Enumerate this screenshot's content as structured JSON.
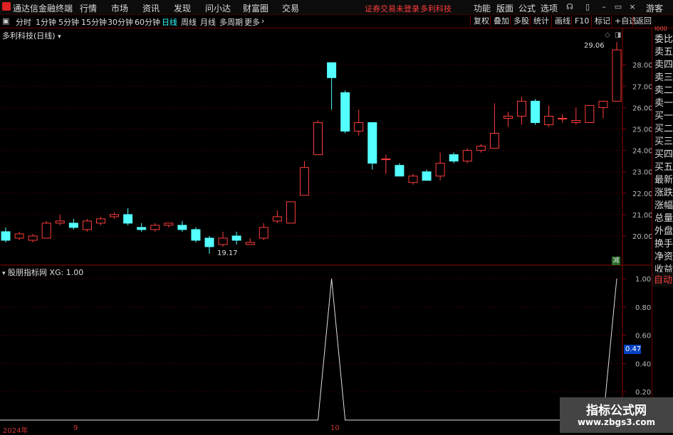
{
  "app": {
    "title": "通达信金融终端"
  },
  "menu": [
    "行情",
    "市场",
    "资讯",
    "发现",
    "问小达",
    "财富圈",
    "交易"
  ],
  "warning": "证券交易未登录",
  "stock_name": "多利科技",
  "right_menu": [
    "功能",
    "版面",
    "公式",
    "选项"
  ],
  "guest": "游客",
  "periods": [
    "分时",
    "1分钟",
    "5分钟",
    "15分钟",
    "30分钟",
    "60分钟",
    "日线",
    "周线",
    "月线",
    "多周期",
    "更多"
  ],
  "active_period": "日线",
  "tools": [
    "复权",
    "叠加",
    "多股",
    "统计",
    "画线",
    "F10",
    "标记",
    "+自选",
    "返回"
  ],
  "chart_title": "多利科技(日线)",
  "right_panel": [
    "委比",
    "卖五",
    "卖四",
    "卖三",
    "卖二",
    "卖一",
    "买一",
    "买二",
    "买三",
    "买四",
    "买五",
    "最新",
    "涨跌",
    "涨幅",
    "总量",
    "外盘",
    "换手",
    "净资",
    "收益"
  ],
  "auto_label": "自动",
  "max_label": "29.06",
  "min_label": "19.17",
  "jian": "减",
  "indicator_title": "股朋指标网  XG: 1.00",
  "indicator_current": "0.47",
  "dates": [
    "2024年",
    "9",
    "10"
  ],
  "watermark": {
    "line1": "指标公式网",
    "line2": "www.zbgs3.com"
  },
  "chart_data": {
    "type": "candlestick",
    "title": "多利科技(日线)",
    "y_ticks": [
      20.0,
      21.0,
      22.0,
      23.0,
      24.0,
      25.0,
      26.0,
      27.0,
      28.0
    ],
    "candles": [
      {
        "o": 20.2,
        "c": 19.8,
        "h": 20.4,
        "l": 19.7
      },
      {
        "o": 19.9,
        "c": 20.1,
        "h": 20.2,
        "l": 19.8
      },
      {
        "o": 19.8,
        "c": 20.0,
        "h": 20.1,
        "l": 19.7
      },
      {
        "o": 19.9,
        "c": 20.6,
        "h": 20.7,
        "l": 19.9
      },
      {
        "o": 20.6,
        "c": 20.7,
        "h": 21.0,
        "l": 20.5
      },
      {
        "o": 20.6,
        "c": 20.4,
        "h": 20.8,
        "l": 20.3
      },
      {
        "o": 20.3,
        "c": 20.7,
        "h": 20.8,
        "l": 20.2
      },
      {
        "o": 20.6,
        "c": 20.8,
        "h": 20.9,
        "l": 20.5
      },
      {
        "o": 20.9,
        "c": 21.0,
        "h": 21.1,
        "l": 20.8
      },
      {
        "o": 21.0,
        "c": 20.6,
        "h": 21.3,
        "l": 20.5
      },
      {
        "o": 20.4,
        "c": 20.3,
        "h": 20.6,
        "l": 20.2
      },
      {
        "o": 20.3,
        "c": 20.5,
        "h": 20.6,
        "l": 20.2
      },
      {
        "o": 20.5,
        "c": 20.6,
        "h": 20.6,
        "l": 20.4
      },
      {
        "o": 20.5,
        "c": 20.3,
        "h": 20.7,
        "l": 20.2
      },
      {
        "o": 20.3,
        "c": 19.8,
        "h": 20.4,
        "l": 19.7
      },
      {
        "o": 19.9,
        "c": 19.5,
        "h": 20.0,
        "l": 19.17
      },
      {
        "o": 19.6,
        "c": 19.9,
        "h": 20.2,
        "l": 19.5
      },
      {
        "o": 20.0,
        "c": 19.8,
        "h": 20.2,
        "l": 19.6
      },
      {
        "o": 19.6,
        "c": 19.7,
        "h": 19.9,
        "l": 19.6
      },
      {
        "o": 19.9,
        "c": 20.4,
        "h": 20.6,
        "l": 19.8
      },
      {
        "o": 20.7,
        "c": 20.9,
        "h": 21.2,
        "l": 20.6
      },
      {
        "o": 20.6,
        "c": 21.6,
        "h": 21.6,
        "l": 20.6
      },
      {
        "o": 21.9,
        "c": 23.2,
        "h": 23.5,
        "l": 21.9
      },
      {
        "o": 23.8,
        "c": 25.3,
        "h": 25.4,
        "l": 23.8
      },
      {
        "o": 28.1,
        "c": 27.4,
        "h": 28.1,
        "l": 25.9
      },
      {
        "o": 26.7,
        "c": 24.9,
        "h": 26.8,
        "l": 24.8
      },
      {
        "o": 24.9,
        "c": 25.3,
        "h": 25.9,
        "l": 24.7
      },
      {
        "o": 25.3,
        "c": 23.4,
        "h": 25.3,
        "l": 23.1
      },
      {
        "o": 23.6,
        "c": 23.6,
        "h": 23.8,
        "l": 22.9
      },
      {
        "o": 23.3,
        "c": 22.8,
        "h": 23.4,
        "l": 22.8
      },
      {
        "o": 22.5,
        "c": 22.8,
        "h": 22.9,
        "l": 22.4
      },
      {
        "o": 23.0,
        "c": 22.6,
        "h": 23.1,
        "l": 22.6
      },
      {
        "o": 22.8,
        "c": 23.4,
        "h": 23.9,
        "l": 22.6
      },
      {
        "o": 23.8,
        "c": 23.5,
        "h": 23.9,
        "l": 23.4
      },
      {
        "o": 23.5,
        "c": 24.0,
        "h": 24.1,
        "l": 23.4
      },
      {
        "o": 24.0,
        "c": 24.2,
        "h": 24.3,
        "l": 23.9
      },
      {
        "o": 24.1,
        "c": 24.8,
        "h": 26.2,
        "l": 24.1
      },
      {
        "o": 25.5,
        "c": 25.6,
        "h": 25.8,
        "l": 25.1
      },
      {
        "o": 25.6,
        "c": 26.3,
        "h": 26.5,
        "l": 25.2
      },
      {
        "o": 26.3,
        "c": 25.3,
        "h": 26.4,
        "l": 25.2
      },
      {
        "o": 25.2,
        "c": 25.6,
        "h": 26.1,
        "l": 25.1
      },
      {
        "o": 25.5,
        "c": 25.5,
        "h": 25.7,
        "l": 25.3
      },
      {
        "o": 25.3,
        "c": 25.4,
        "h": 26.0,
        "l": 25.2
      },
      {
        "o": 25.3,
        "c": 26.1,
        "h": 26.1,
        "l": 25.3
      },
      {
        "o": 26.0,
        "c": 26.3,
        "h": 26.3,
        "l": 25.5
      },
      {
        "o": 26.3,
        "c": 28.7,
        "h": 29.06,
        "l": 26.3
      }
    ],
    "indicator": {
      "name": "XG",
      "y_ticks": [
        0.2,
        0.4,
        0.6,
        0.8,
        1.0
      ],
      "values": [
        0,
        0,
        0,
        0,
        0,
        0,
        0,
        0,
        0,
        0,
        0,
        0,
        0,
        0,
        0,
        0,
        0,
        0,
        0,
        0,
        0,
        0,
        0,
        0,
        1,
        0,
        0,
        0,
        0,
        0,
        0,
        0,
        0,
        0,
        0,
        0,
        0,
        0,
        0,
        0,
        0,
        0,
        0,
        0,
        0,
        1
      ]
    }
  }
}
